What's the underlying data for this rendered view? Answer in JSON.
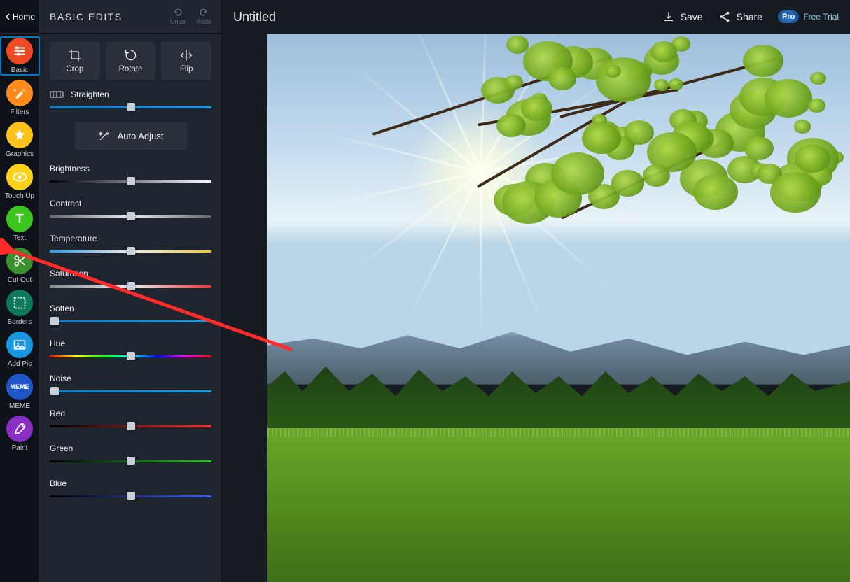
{
  "home_label": "Home",
  "panel_title": "BASIC EDITS",
  "undo_label": "Undo",
  "redo_label": "Redo",
  "doc_title": "Untitled",
  "save_label": "Save",
  "share_label": "Share",
  "pro_label": "Pro",
  "trial_label": "Free Trial",
  "sidebar": [
    {
      "label": "Basic",
      "color": "#f04a24"
    },
    {
      "label": "Filters",
      "color": "#ff8c1a"
    },
    {
      "label": "Graphics",
      "color": "#ffc21a"
    },
    {
      "label": "Touch Up",
      "color": "#ffd21a"
    },
    {
      "label": "Text",
      "color": "#3bc41d"
    },
    {
      "label": "Cut Out",
      "color": "#3a8f2e"
    },
    {
      "label": "Borders",
      "color": "#0e7a5b"
    },
    {
      "label": "Add Pic",
      "color": "#1797e0"
    },
    {
      "label": "MEME",
      "color": "#1f57c9"
    },
    {
      "label": "Paint",
      "color": "#8a2fc4"
    }
  ],
  "tool_buttons": {
    "crop": "Crop",
    "rotate": "Rotate",
    "flip": "Flip"
  },
  "straighten_label": "Straighten",
  "auto_adjust_label": "Auto Adjust",
  "sliders": {
    "brightness": {
      "label": "Brightness",
      "pos": 50,
      "track": "track-bright"
    },
    "contrast": {
      "label": "Contrast",
      "pos": 50,
      "track": "track-mono"
    },
    "temperature": {
      "label": "Temperature",
      "pos": 50,
      "track": "track-temp"
    },
    "saturation": {
      "label": "Saturation",
      "pos": 50,
      "track": "track-sat"
    },
    "soften": {
      "label": "Soften",
      "pos": 3,
      "track": "track-blue"
    },
    "hue": {
      "label": "Hue",
      "pos": 50,
      "track": "track-hue"
    },
    "noise": {
      "label": "Noise",
      "pos": 3,
      "track": "track-blue"
    },
    "red": {
      "label": "Red",
      "pos": 50,
      "track": "track-red"
    },
    "green": {
      "label": "Green",
      "pos": 50,
      "track": "track-green"
    },
    "blue": {
      "label": "Blue",
      "pos": 50,
      "track": "track-bluec"
    }
  },
  "straighten_slider": {
    "pos": 50,
    "track": "track-blue"
  }
}
